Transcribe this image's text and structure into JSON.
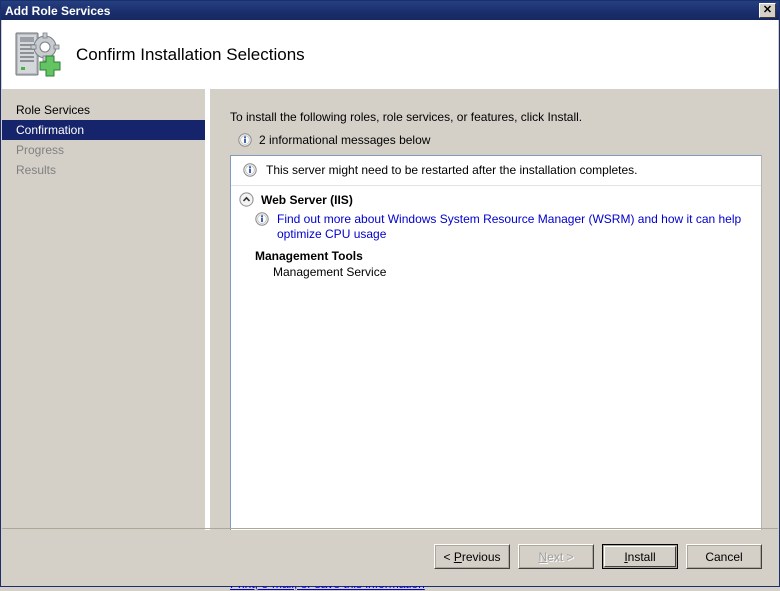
{
  "window": {
    "title": "Add Role Services",
    "close_icon": "close-icon",
    "close_glyph": "✕",
    "titlebar_color": "#1b2f6e",
    "face_color": "#d4d0c8"
  },
  "header": {
    "icon": "server-add-role-icon",
    "title": "Confirm Installation Selections"
  },
  "sidebar": {
    "items": [
      {
        "label": "Role Services",
        "state": "normal"
      },
      {
        "label": "Confirmation",
        "state": "selected"
      },
      {
        "label": "Progress",
        "state": "disabled"
      },
      {
        "label": "Results",
        "state": "disabled"
      }
    ]
  },
  "content": {
    "intro": "To install the following roles, role services, or features, click Install.",
    "info_summary": "2 informational messages below",
    "info_icon": "info-icon",
    "panel": {
      "restart_message": "This server might need to be restarted after the installation completes.",
      "group": {
        "collapse_icon": "chevron-up-icon",
        "title": "Web Server (IIS)",
        "link": "Find out more about Windows System Resource Manager (WSRM) and how it can help optimize CPU usage",
        "link_color": "#0000cc",
        "subgroup": {
          "title": "Management Tools",
          "items": [
            "Management Service"
          ]
        }
      }
    },
    "print_link": "Print, e-mail, or save this information"
  },
  "footer": {
    "buttons": [
      {
        "name": "previous-button",
        "pre": "< ",
        "accel": "P",
        "post": "revious",
        "state": "enabled"
      },
      {
        "name": "next-button",
        "pre": "",
        "accel": "N",
        "post": "ext >",
        "state": "disabled"
      },
      {
        "name": "install-button",
        "pre": "",
        "accel": "I",
        "post": "nstall",
        "state": "default"
      },
      {
        "name": "cancel-button",
        "pre": "Cancel",
        "accel": "",
        "post": "",
        "state": "enabled"
      }
    ]
  }
}
